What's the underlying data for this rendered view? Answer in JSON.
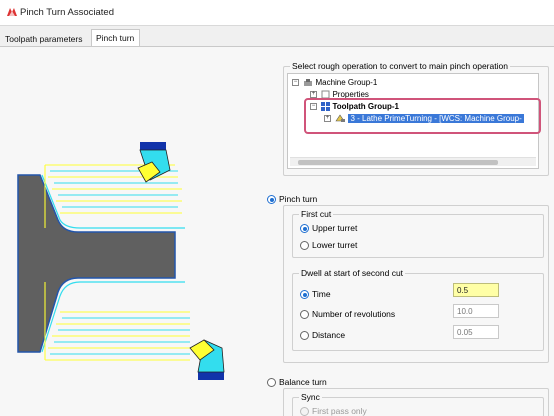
{
  "window": {
    "title": "Pinch Turn Associated"
  },
  "tabs": [
    {
      "label": "Toolpath parameters",
      "active": false
    },
    {
      "label": "Pinch turn",
      "active": true
    }
  ],
  "operation_select": {
    "label": "Select rough operation to convert to main pinch operation",
    "tree": [
      {
        "label": "Machine Group-1",
        "icon": "machine-icon"
      },
      {
        "label": "Properties",
        "icon": "properties-icon"
      },
      {
        "label": "Toolpath Group-1",
        "icon": "toolpath-group-icon"
      },
      {
        "label": "3 - Lathe PrimeTurning - [WCS: Machine Group-",
        "icon": "operation-icon",
        "selected": true
      }
    ]
  },
  "pinch_turn": {
    "label": "Pinch turn",
    "selected": true,
    "first_cut": {
      "label": "First cut",
      "options": [
        {
          "label": "Upper turret",
          "selected": true
        },
        {
          "label": "Lower turret",
          "selected": false
        }
      ]
    },
    "dwell": {
      "label": "Dwell at start of second cut",
      "options": [
        {
          "label": "Time",
          "selected": true,
          "value": "0.5"
        },
        {
          "label": "Number of revolutions",
          "selected": false,
          "value": "10.0"
        },
        {
          "label": "Distance",
          "selected": false,
          "value": "0.05"
        }
      ]
    }
  },
  "balance_turn": {
    "label": "Balance turn",
    "selected": false,
    "sync": {
      "label": "Sync",
      "first_pass_only": "First pass only"
    }
  },
  "colors": {
    "accent": "#1f6fd1",
    "selection": "#3a78d8",
    "highlight_border": "#d0547a",
    "toolpath_yellow": "#ffff33",
    "toolpath_cyan": "#33ddee"
  }
}
